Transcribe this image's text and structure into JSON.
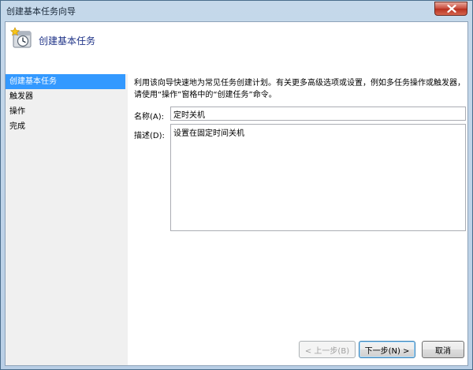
{
  "window": {
    "title": "创建基本任务向导"
  },
  "header": {
    "title": "创建基本任务",
    "icon": "task-scheduler-clock-icon"
  },
  "sidebar": {
    "items": [
      {
        "label": "创建基本任务",
        "active": true
      },
      {
        "label": "触发器",
        "active": false
      },
      {
        "label": "操作",
        "active": false
      },
      {
        "label": "完成",
        "active": false
      }
    ]
  },
  "main": {
    "description": "利用该向导快速地为常见任务创建计划。有关更多高级选项或设置，例如多任务操作或触发器，请使用“操作”窗格中的“创建任务”命令。",
    "name_label": "名称(A):",
    "name_value": "定时关机",
    "desc_label": "描述(D):",
    "desc_value": "设置在固定时间关机"
  },
  "footer": {
    "back_label": "< 上一步(B)",
    "next_label": "下一步(N) >",
    "cancel_label": "取消"
  },
  "colors": {
    "accent": "#3399ff",
    "header_title": "#1e3287"
  }
}
